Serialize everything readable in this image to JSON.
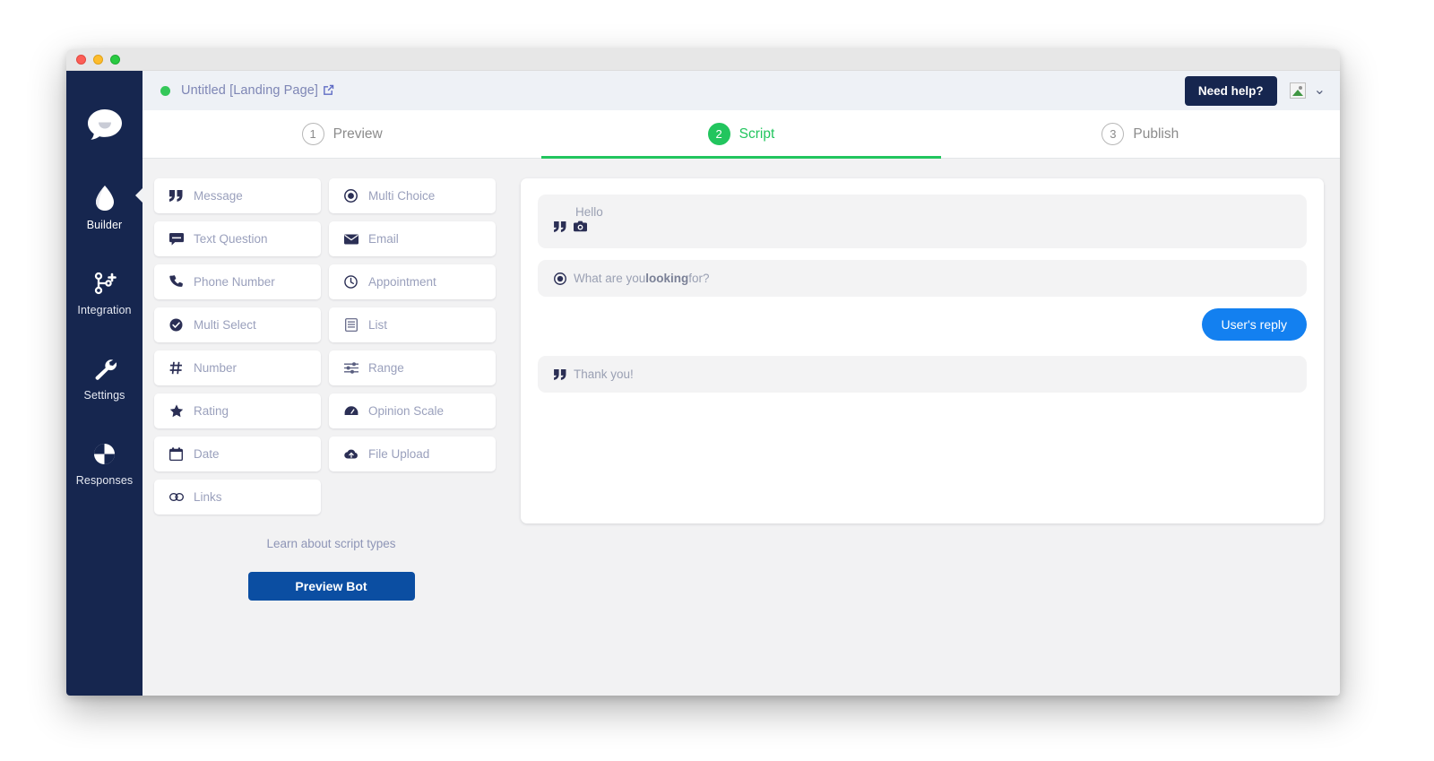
{
  "window": {
    "traffic_lights": [
      "close",
      "minimize",
      "maximize"
    ]
  },
  "sidebar": {
    "logo_icon": "chat-bubble-logo",
    "items": [
      {
        "label": "Builder",
        "icon": "water-drop-icon",
        "active": true
      },
      {
        "label": "Integration",
        "icon": "git-branch-plus-icon",
        "active": false
      },
      {
        "label": "Settings",
        "icon": "wrench-icon",
        "active": false
      },
      {
        "label": "Responses",
        "icon": "pie-chart-icon",
        "active": false
      }
    ],
    "background_color": "#16264f"
  },
  "topbar": {
    "status": "online",
    "status_color": "#34c759",
    "title": "Untitled [Landing Page]",
    "external_link_icon": "external-link-icon",
    "need_help_label": "Need help?",
    "need_help_color": "#16264f",
    "avatar_icon": "broken-image-icon",
    "caret_icon": "chevron-down-icon"
  },
  "tabs": {
    "active_color": "#22c55e",
    "items": [
      {
        "number": "1",
        "label": "Preview",
        "active": false
      },
      {
        "number": "2",
        "label": "Script",
        "active": true
      },
      {
        "number": "3",
        "label": "Publish",
        "active": false
      }
    ]
  },
  "types_panel": {
    "cards": [
      {
        "label": "Message",
        "icon": "quote-icon"
      },
      {
        "label": "Multi Choice",
        "icon": "radio-filled-icon"
      },
      {
        "label": "Text Question",
        "icon": "comment-icon"
      },
      {
        "label": "Email",
        "icon": "envelope-icon"
      },
      {
        "label": "Phone Number",
        "icon": "phone-icon"
      },
      {
        "label": "Appointment",
        "icon": "clock-icon"
      },
      {
        "label": "Multi Select",
        "icon": "check-circle-icon"
      },
      {
        "label": "List",
        "icon": "list-box-icon"
      },
      {
        "label": "Number",
        "icon": "hash-icon"
      },
      {
        "label": "Range",
        "icon": "sliders-icon"
      },
      {
        "label": "Rating",
        "icon": "star-icon"
      },
      {
        "label": "Opinion Scale",
        "icon": "gauge-icon"
      },
      {
        "label": "Date",
        "icon": "calendar-icon"
      },
      {
        "label": "File Upload",
        "icon": "cloud-upload-icon"
      },
      {
        "label": "Links",
        "icon": "link-icon"
      }
    ],
    "learn_link": "Learn about script types",
    "preview_button": "Preview Bot",
    "preview_button_color": "#0b4ea2"
  },
  "script_canvas": {
    "steps": [
      {
        "kind": "message",
        "text": "Hello",
        "icons": [
          "quote-icon",
          "camera-icon"
        ]
      },
      {
        "kind": "multi-choice",
        "icon": "radio-filled-icon",
        "text_before": "What are you ",
        "text_bold": "looking",
        "text_after": " for?"
      },
      {
        "kind": "user-reply",
        "text": "User's reply",
        "color": "#1380f0"
      },
      {
        "kind": "message",
        "icon": "quote-icon",
        "text": "Thank you!"
      }
    ]
  }
}
